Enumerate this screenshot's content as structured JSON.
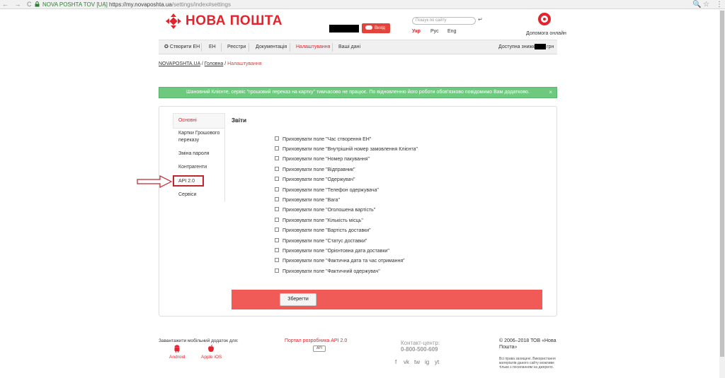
{
  "browser": {
    "nav_glyphs": "← → C",
    "site_name": "NOVA POSHTA TOV [UA]",
    "separator": "|",
    "url_host": "https://my.novaposhta.ua",
    "url_path": "/settings/index#settings",
    "zoom_glyph": "🔍",
    "star_glyph": "☆",
    "menu_glyph": "⋮"
  },
  "header": {
    "logo_text": "НОВА ПОШТА",
    "exit_label": "Вихід",
    "search_placeholder": "Пошук по сайту",
    "enter_glyph": "↵",
    "languages": [
      "Укр",
      "Рус",
      "Eng"
    ],
    "help_label": "Допомога онлайн"
  },
  "menu": {
    "items": [
      "Створити ЕН",
      "ЕН",
      "Реєстри",
      "Документація",
      "Налаштування",
      "Ваші дані"
    ],
    "create_glyph": "✪",
    "balance_label": "Доступна знижка:",
    "currency": "грн"
  },
  "breadcrumb": {
    "home_site": "NOVAPOSHTA.UA",
    "main": "Головна",
    "current": "Налаштування",
    "sep": " / "
  },
  "alert": {
    "text": "Шановний Клієнте, сервіс \"грошовий переказ на картку\" тимчасово не працює. По відновленню його роботи обов'язково повідомимо Вам додатково.",
    "close": "×"
  },
  "sidebar": {
    "items": [
      {
        "label": "Основні"
      },
      {
        "label": "Картки Грошового переказу"
      },
      {
        "label": "Зміна пароля"
      },
      {
        "label": "Контрагенти"
      },
      {
        "label": "API 2.0"
      },
      {
        "label": "Сервіси"
      }
    ]
  },
  "reports": {
    "title": "Звіти",
    "options": [
      "Приховувати поле \"Час створення ЕН\"",
      "Приховувати поле \"Внутрішній номер замовлення Клієнта\"",
      "Приховувати поле \"Номер пакування\"",
      "Приховувати поле \"Відправник\"",
      "Приховувати поле \"Одержувач\"",
      "Приховувати поле \"Телефон одержувача\"",
      "Приховувати поле \"Вага\"",
      "Приховувати поле \"Оголошена вартість\"",
      "Приховувати поле \"Кількість місць\"",
      "Приховувати поле \"Вартість доставки\"",
      "Приховувати поле \"Статус доставки\"",
      "Приховувати поле \"Орієнтовна дата доставки\"",
      "Приховувати поле \"Фактична дата та час отримання\"",
      "Приховувати поле \"Фактичний одержувач\""
    ],
    "save_label": "Зберегти"
  },
  "footer": {
    "app_label": "Завантажити мобільний додаток для:",
    "android": "Android",
    "ios": "Apple iOS",
    "dev_portal": "Портал розробника API 2.0",
    "api_badge": "API",
    "contact_label": "Контакт-центр:",
    "phone": "0-800-500-609",
    "copyright": "© 2006–2018 ТОВ «Нова Пошта»",
    "rights_note": "Всі права захищені. Використання матеріалів даного сайту можливе тільки з посиланням на джерело.",
    "social": [
      "f",
      "vk",
      "tw",
      "ig",
      "yt"
    ]
  },
  "colors": {
    "brand_red": "#e3232d",
    "alert_green": "#6cc97e",
    "save_bar": "#f05b57",
    "highlight_box": "#c0262f"
  }
}
